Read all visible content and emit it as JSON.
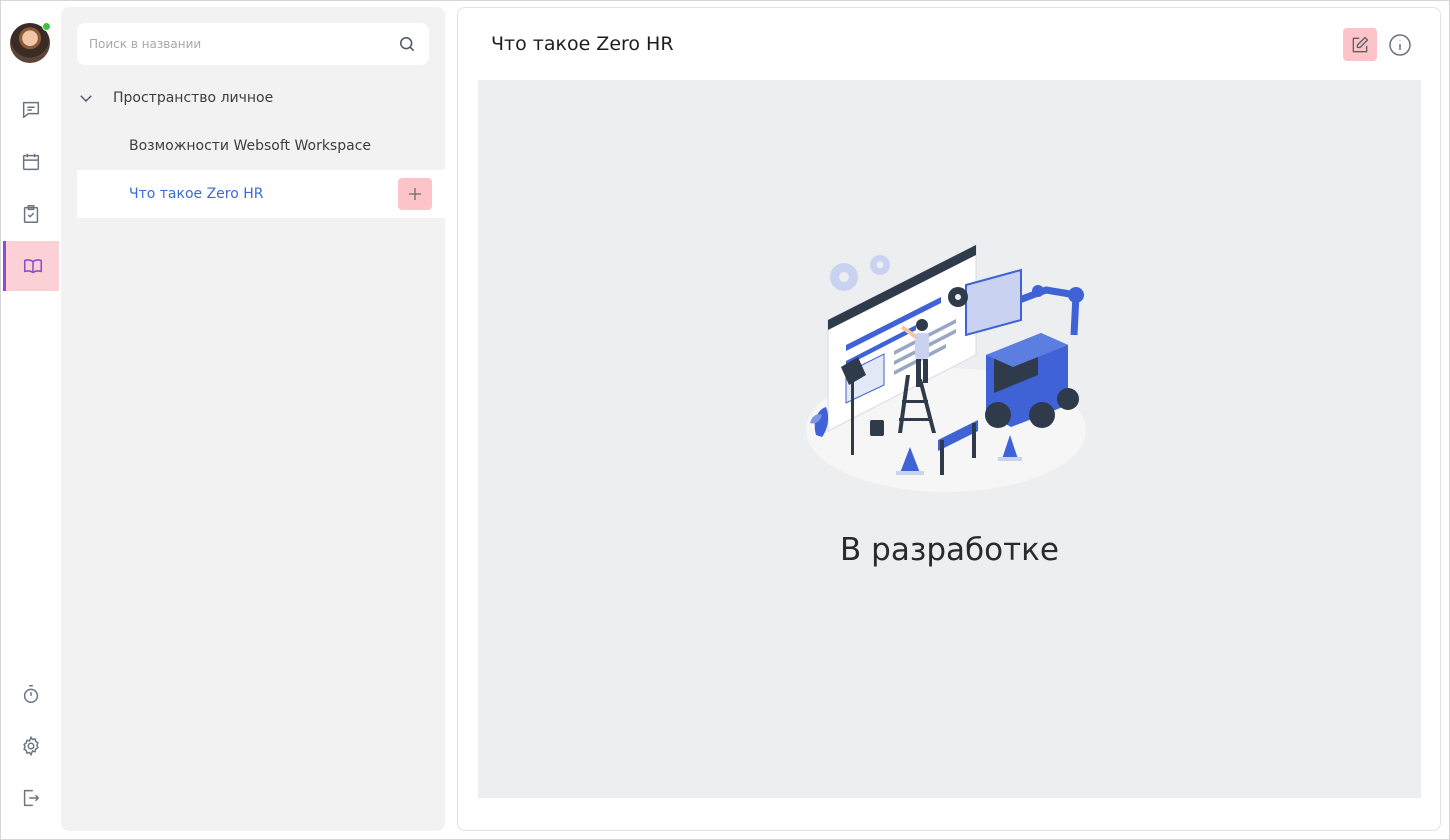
{
  "rail": {
    "items": [
      {
        "icon": "chat-icon"
      },
      {
        "icon": "calendar-icon"
      },
      {
        "icon": "clipboard-check-icon"
      },
      {
        "icon": "book-icon",
        "active": true
      },
      {
        "icon": "stopwatch-icon"
      },
      {
        "icon": "gear-icon"
      },
      {
        "icon": "logout-icon"
      }
    ],
    "presence_color": "#3cc23c",
    "active_color": "#8a4dd6"
  },
  "tree": {
    "search": {
      "placeholder": "Поиск в названии",
      "value": ""
    },
    "root": {
      "label": "Пространство личное",
      "expanded": true
    },
    "items": [
      {
        "label": "Возможности Websoft Workspace"
      },
      {
        "label": "Что такое Zero HR",
        "selected": true
      }
    ]
  },
  "main": {
    "title": "Что такое Zero HR",
    "status": "В разработке"
  },
  "colors": {
    "accent_blue": "#3a6ad6",
    "button_pink": "#fcc4c8",
    "panel_gray": "#f2f2f2"
  }
}
